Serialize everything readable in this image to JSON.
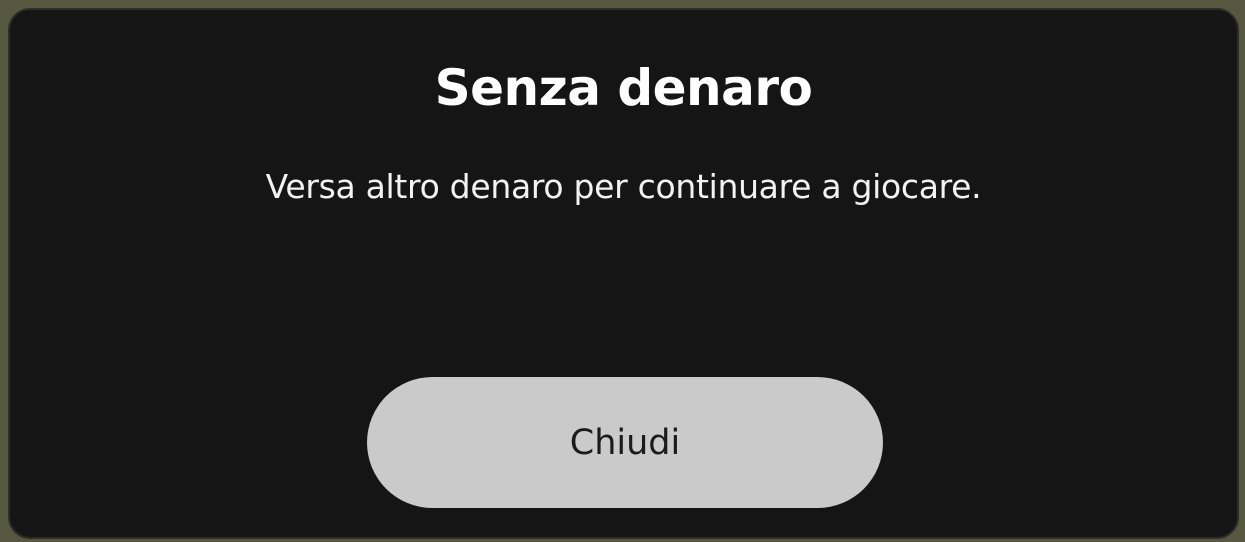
{
  "dialog": {
    "title": "Senza denaro",
    "message": "Versa altro denaro per continuare a giocare.",
    "close_label": "Chiudi"
  },
  "colors": {
    "dialog_background": "#151515",
    "button_background": "#cacaca",
    "button_text": "#1b1b1b",
    "title_text": "#ffffff"
  }
}
